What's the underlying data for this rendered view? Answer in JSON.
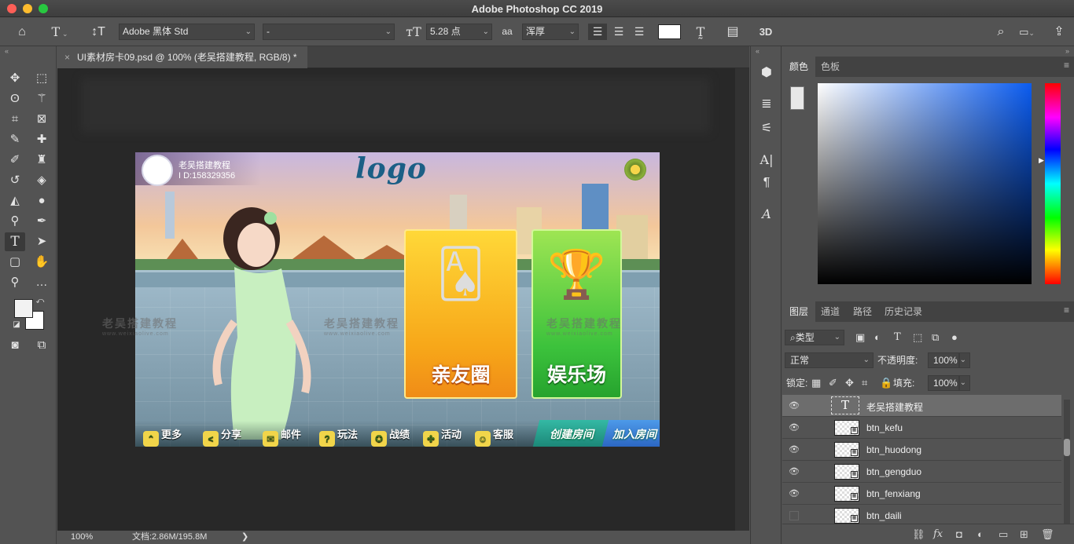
{
  "app": {
    "title": "Adobe Photoshop CC 2019"
  },
  "options": {
    "font_family": "Adobe 黑体 Std",
    "font_style": "-",
    "font_size": "5.28 点",
    "antialias_icon": "aa",
    "antialias": "浑厚",
    "text_color": "#ffffff",
    "three_d": "3D"
  },
  "document": {
    "tab_label": "UI素材房卡09.psd @ 100% (老吴搭建教程, RGB/8) *",
    "zoom": "100%",
    "doc_size": "文档:2.86M/195.8M",
    "status_chevron": "❯"
  },
  "artwork": {
    "nickname": "老吴搭建教程",
    "uid": "I D:158329356",
    "logo": "logo",
    "card_friends": "亲友圈",
    "card_fun": "娱乐场",
    "bottom_items": [
      "更多",
      "分享",
      "邮件",
      "玩法",
      "战绩",
      "活动",
      "客服"
    ],
    "create_room": "创建房间",
    "join_room": "加入房间",
    "watermark_cn": "老吴搭建教程",
    "watermark_url": "www.weixiaolive.com"
  },
  "color_panel": {
    "tabs": [
      "颜色",
      "色板"
    ],
    "active_tab": "颜色"
  },
  "layers_panel": {
    "tabs": [
      "图层",
      "通道",
      "路径",
      "历史记录"
    ],
    "active_tab": "图层",
    "filter_type": "类型",
    "blend_mode": "正常",
    "opacity_label": "不透明度:",
    "opacity": "100%",
    "lock_label": "锁定:",
    "fill_label": "填充:",
    "fill": "100%",
    "layers": [
      {
        "name": "老吴搭建教程",
        "kind": "text",
        "visible": true,
        "selected": true
      },
      {
        "name": "btn_kefu",
        "kind": "smart",
        "visible": true,
        "selected": false
      },
      {
        "name": "btn_huodong",
        "kind": "smart",
        "visible": true,
        "selected": false
      },
      {
        "name": "btn_gengduo",
        "kind": "smart",
        "visible": true,
        "selected": false
      },
      {
        "name": "btn_fenxiang",
        "kind": "smart",
        "visible": true,
        "selected": false
      },
      {
        "name": "btn_daili",
        "kind": "smart",
        "visible": false,
        "selected": false
      }
    ],
    "footer_fx": "fx"
  }
}
